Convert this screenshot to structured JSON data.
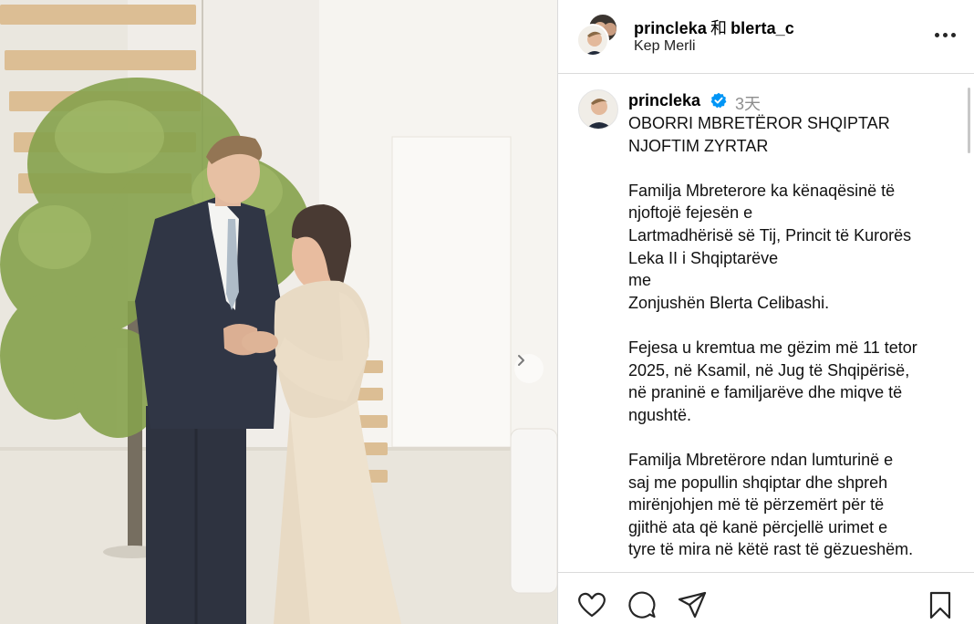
{
  "post": {
    "owner": "princleka",
    "collaborator": "blerta_c",
    "connector": "和",
    "location": "Kep Merli",
    "time_ago": "3天"
  },
  "caption": {
    "username": "princleka",
    "paragraphs": [
      "OBORRI MBRETËROR SHQIPTAR\nNJOFTIM ZYRTAR",
      "Familja Mbreterore ka kënaqësinë të\nnjoftojë fejesën e\nLartmadhërisë së Tij, Princit të Kurorës\nLeka II i Shqiptarëve\nme\nZonjushën Blerta Celibashi.",
      "Fejesa u kremtua me gëzim më 11 tetor\n2025, në Ksamil, në Jug të Shqipërisë,\nnë praninë e familjarëve dhe miqve të\nngushtë.",
      "Familja Mbretërore ndan lumturinë e\nsaj me popullin shqiptar dhe shpreh\nmirënjohjen më të përzemërt për të\ngjithë ata që kanë përcjellë urimet e\ntyre të mira në këtë rast të gëzueshëm."
    ]
  },
  "icons": {
    "more": "more-options-icon",
    "next": "chevron-right-icon",
    "verified": "verified-badge-icon",
    "like": "heart-icon",
    "comment": "comment-icon",
    "share": "share-icon",
    "save": "bookmark-icon"
  },
  "colors": {
    "verified_blue": "#0095f6",
    "muted_text": "#8e8e8e",
    "divider": "#dbdbdb",
    "icon": "#262626"
  }
}
